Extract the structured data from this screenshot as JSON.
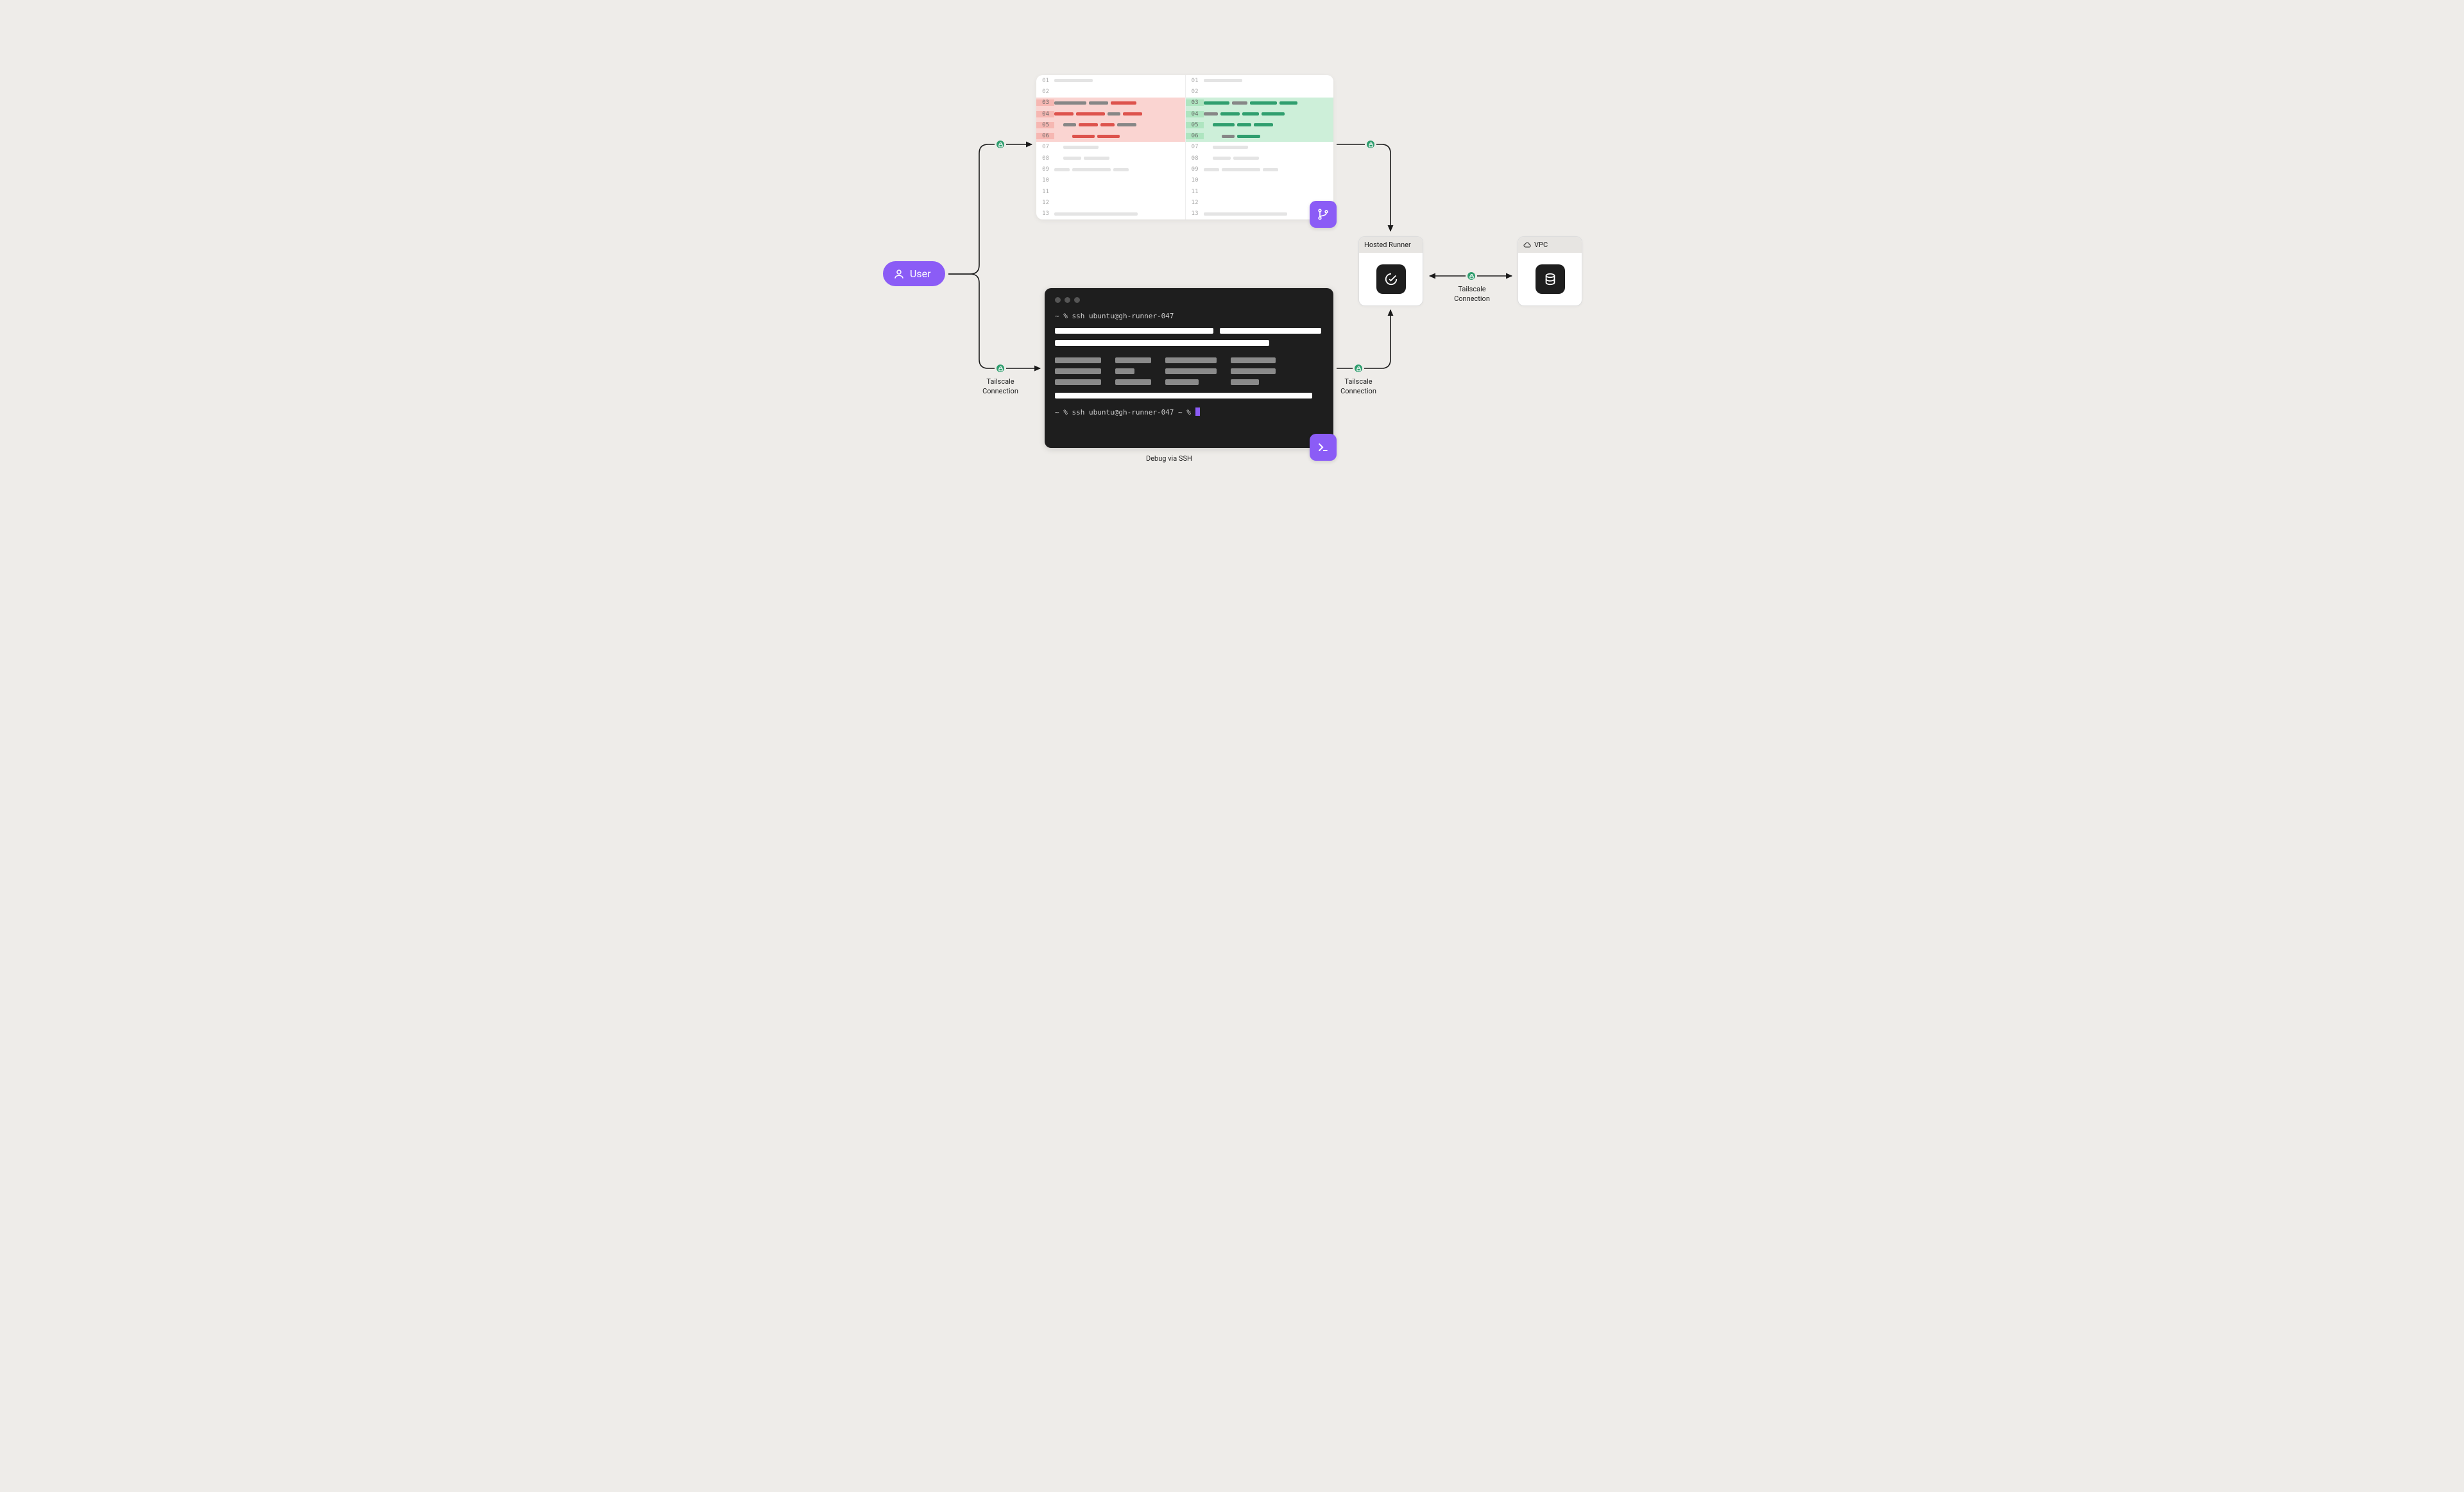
{
  "user": {
    "label": "User"
  },
  "diff": {
    "line_numbers": [
      "01",
      "02",
      "03",
      "04",
      "05",
      "06",
      "07",
      "08",
      "09",
      "10",
      "11",
      "12",
      "13"
    ]
  },
  "terminal": {
    "prompt1": "~ % ssh  ubuntu@gh-runner-047",
    "prompt2": "~ % ssh  ubuntu@gh-runner-047 ~ %",
    "caption": "Debug via SSH"
  },
  "cards": {
    "runner": {
      "title": "Hosted Runner"
    },
    "vpc": {
      "title": "VPC"
    }
  },
  "labels": {
    "tailscale_connection_l1": "Tailscale",
    "tailscale_connection_l2": "Connection"
  }
}
